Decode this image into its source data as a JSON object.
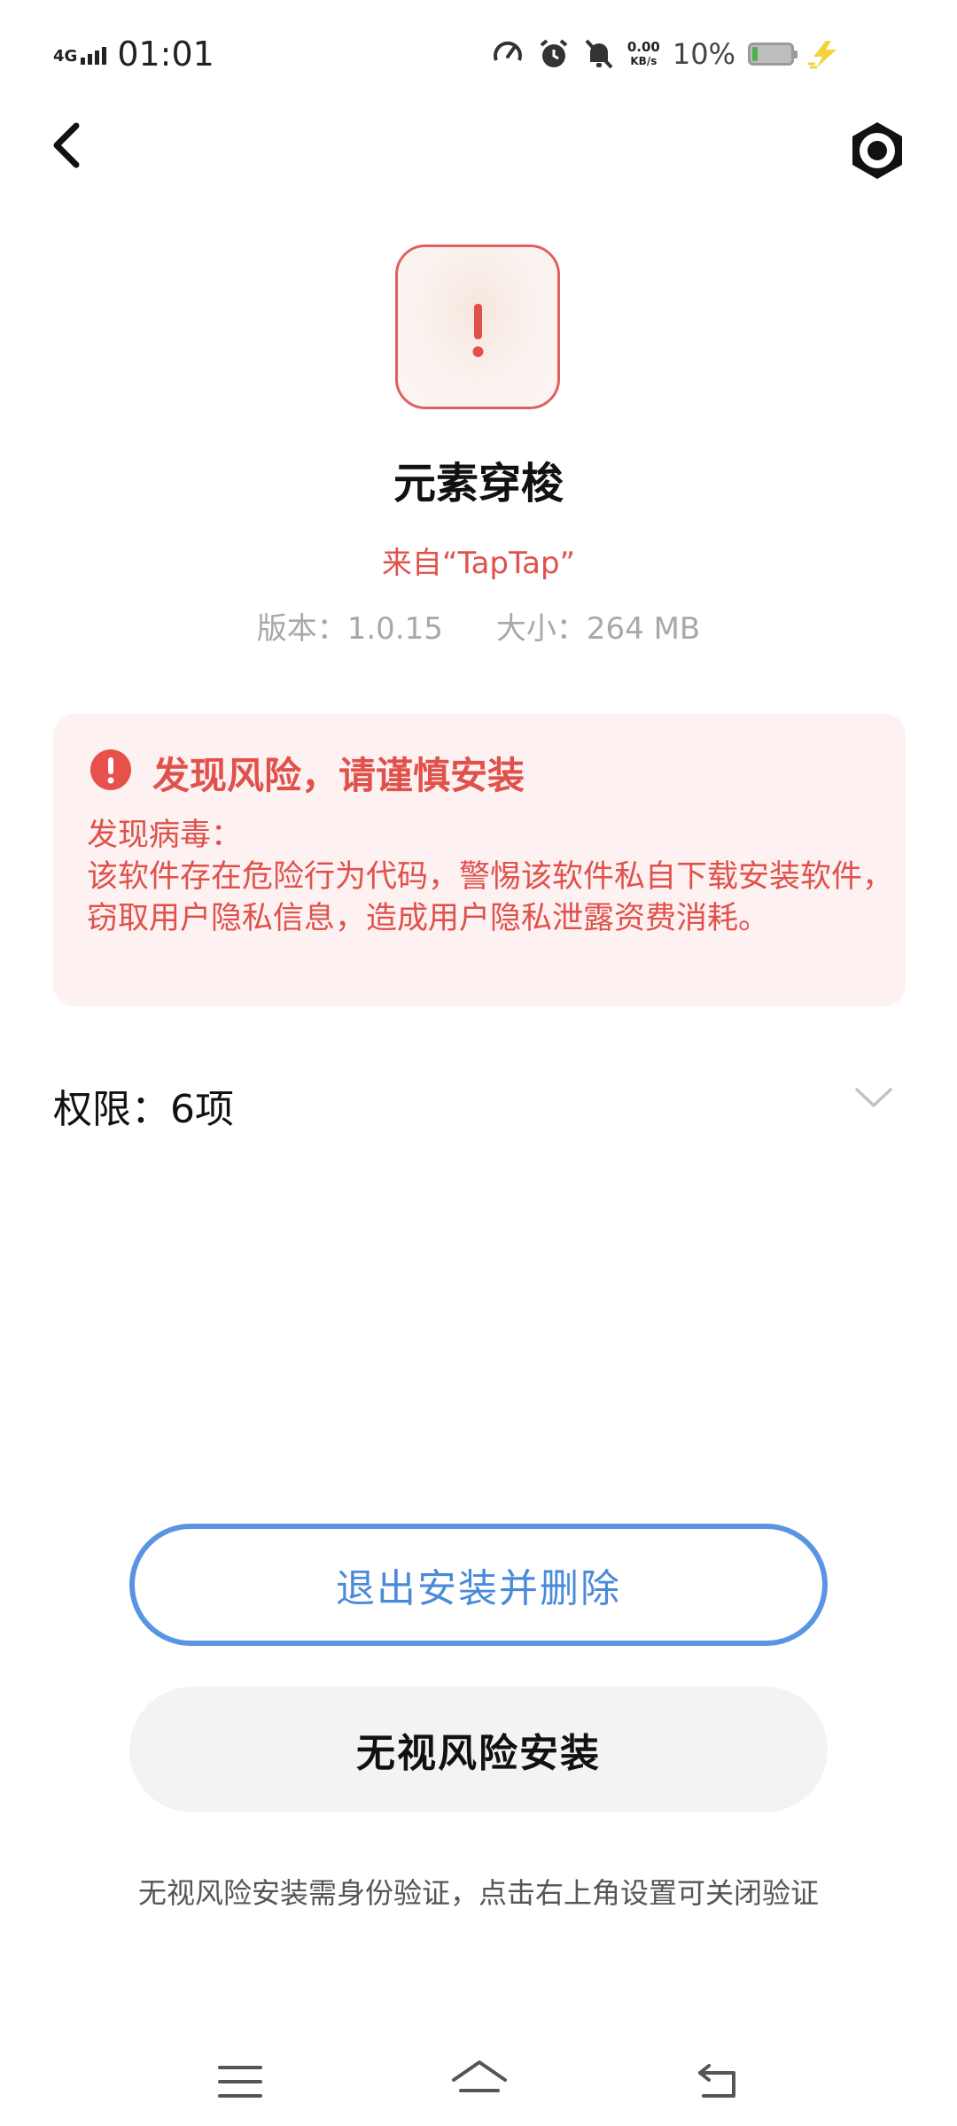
{
  "status_bar": {
    "network": "4G",
    "time": "01:01",
    "net_speed_value": "0.00",
    "net_speed_unit": "KB/s",
    "battery_percent": "10%",
    "icons": [
      "speedometer-icon",
      "alarm-icon",
      "mute-icon",
      "battery-icon",
      "charging-bolt-icon"
    ]
  },
  "header": {
    "back_icon": "chevron-left-icon",
    "settings_icon": "settings-gear-icon"
  },
  "app": {
    "icon": "risk-alert-app-icon",
    "name": "元素穿梭",
    "source": "来自“TapTap”",
    "version_label": "版本：1.0.15",
    "size_label": "大小：264  MB"
  },
  "warning": {
    "icon": "exclamation-circle-icon",
    "title": "发现风险，请谨慎安装",
    "body_heading": "发现病毒：",
    "body_text": "该软件存在危险行为代码，警惕该软件私自下载安装软件，窃取用户隐私信息，造成用户隐私泄露资费消耗。"
  },
  "permissions": {
    "label": "权限：6项",
    "chevron_icon": "chevron-down-icon"
  },
  "actions": {
    "exit_label": "退出安装并删除",
    "ignore_label": "无视风险安装",
    "footnote": "无视风险安装需身份验证，点击右上角设置可关闭验证"
  },
  "nav_bar": {
    "icons": [
      "menu-icon",
      "home-icon",
      "back-icon"
    ]
  },
  "colors": {
    "danger": "#e0514b",
    "accent": "#5a95e3",
    "warning_bg": "#fdf1f1"
  }
}
